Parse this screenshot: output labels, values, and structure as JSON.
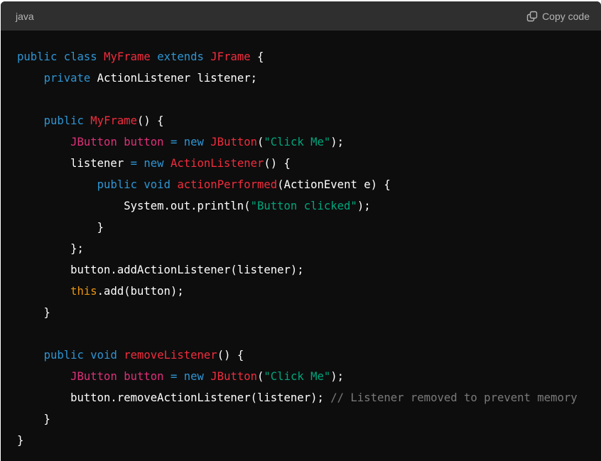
{
  "header": {
    "language": "java",
    "copy_label": "Copy code"
  },
  "colors": {
    "keyword": "#2e95d3",
    "type": "#f22c3d",
    "string": "#00a67d",
    "local_type": "#df3079",
    "this": "#e9950c",
    "comment": "#7a7a7a",
    "plain": "#ffffff"
  },
  "code": {
    "lines": [
      [
        [
          "kw",
          "public"
        ],
        [
          "pl",
          " "
        ],
        [
          "kw",
          "class"
        ],
        [
          "pl",
          " "
        ],
        [
          "ty",
          "MyFrame"
        ],
        [
          "pl",
          " "
        ],
        [
          "kw",
          "extends"
        ],
        [
          "pl",
          " "
        ],
        [
          "ty",
          "JFrame"
        ],
        [
          "pl",
          " {"
        ]
      ],
      [
        [
          "pl",
          "    "
        ],
        [
          "kw",
          "private"
        ],
        [
          "pl",
          " ActionListener listener;"
        ]
      ],
      [],
      [
        [
          "pl",
          "    "
        ],
        [
          "kw",
          "public"
        ],
        [
          "pl",
          " "
        ],
        [
          "ty",
          "MyFrame"
        ],
        [
          "pl",
          "() {"
        ]
      ],
      [
        [
          "pl",
          "        "
        ],
        [
          "th",
          "JButton"
        ],
        [
          "pl",
          " "
        ],
        [
          "th",
          "button"
        ],
        [
          "pl",
          " "
        ],
        [
          "kw",
          "="
        ],
        [
          "pl",
          " "
        ],
        [
          "kw",
          "new"
        ],
        [
          "pl",
          " "
        ],
        [
          "ty",
          "JButton"
        ],
        [
          "pl",
          "("
        ],
        [
          "st",
          "\"Click Me\""
        ],
        [
          "pl",
          ");"
        ]
      ],
      [
        [
          "pl",
          "        listener "
        ],
        [
          "kw",
          "="
        ],
        [
          "pl",
          " "
        ],
        [
          "kw",
          "new"
        ],
        [
          "pl",
          " "
        ],
        [
          "ty",
          "ActionListener"
        ],
        [
          "pl",
          "() {"
        ]
      ],
      [
        [
          "pl",
          "            "
        ],
        [
          "kw",
          "public"
        ],
        [
          "pl",
          " "
        ],
        [
          "kw",
          "void"
        ],
        [
          "pl",
          " "
        ],
        [
          "ty",
          "actionPerformed"
        ],
        [
          "pl",
          "(ActionEvent e) {"
        ]
      ],
      [
        [
          "pl",
          "                System.out.println("
        ],
        [
          "st",
          "\"Button clicked\""
        ],
        [
          "pl",
          ");"
        ]
      ],
      [
        [
          "pl",
          "            }"
        ]
      ],
      [
        [
          "pl",
          "        };"
        ]
      ],
      [
        [
          "pl",
          "        button.addActionListener(listener);"
        ]
      ],
      [
        [
          "pl",
          "        "
        ],
        [
          "sp",
          "this"
        ],
        [
          "pl",
          ".add(button);"
        ]
      ],
      [
        [
          "pl",
          "    }"
        ]
      ],
      [],
      [
        [
          "pl",
          "    "
        ],
        [
          "kw",
          "public"
        ],
        [
          "pl",
          " "
        ],
        [
          "kw",
          "void"
        ],
        [
          "pl",
          " "
        ],
        [
          "ty",
          "removeListener"
        ],
        [
          "pl",
          "() {"
        ]
      ],
      [
        [
          "pl",
          "        "
        ],
        [
          "th",
          "JButton"
        ],
        [
          "pl",
          " "
        ],
        [
          "th",
          "button"
        ],
        [
          "pl",
          " "
        ],
        [
          "kw",
          "="
        ],
        [
          "pl",
          " "
        ],
        [
          "kw",
          "new"
        ],
        [
          "pl",
          " "
        ],
        [
          "ty",
          "JButton"
        ],
        [
          "pl",
          "("
        ],
        [
          "st",
          "\"Click Me\""
        ],
        [
          "pl",
          ");"
        ]
      ],
      [
        [
          "pl",
          "        button.removeActionListener(listener); "
        ],
        [
          "cm",
          "// Listener removed to prevent memory"
        ]
      ],
      [
        [
          "pl",
          "    }"
        ]
      ],
      [
        [
          "pl",
          "}"
        ]
      ]
    ]
  }
}
